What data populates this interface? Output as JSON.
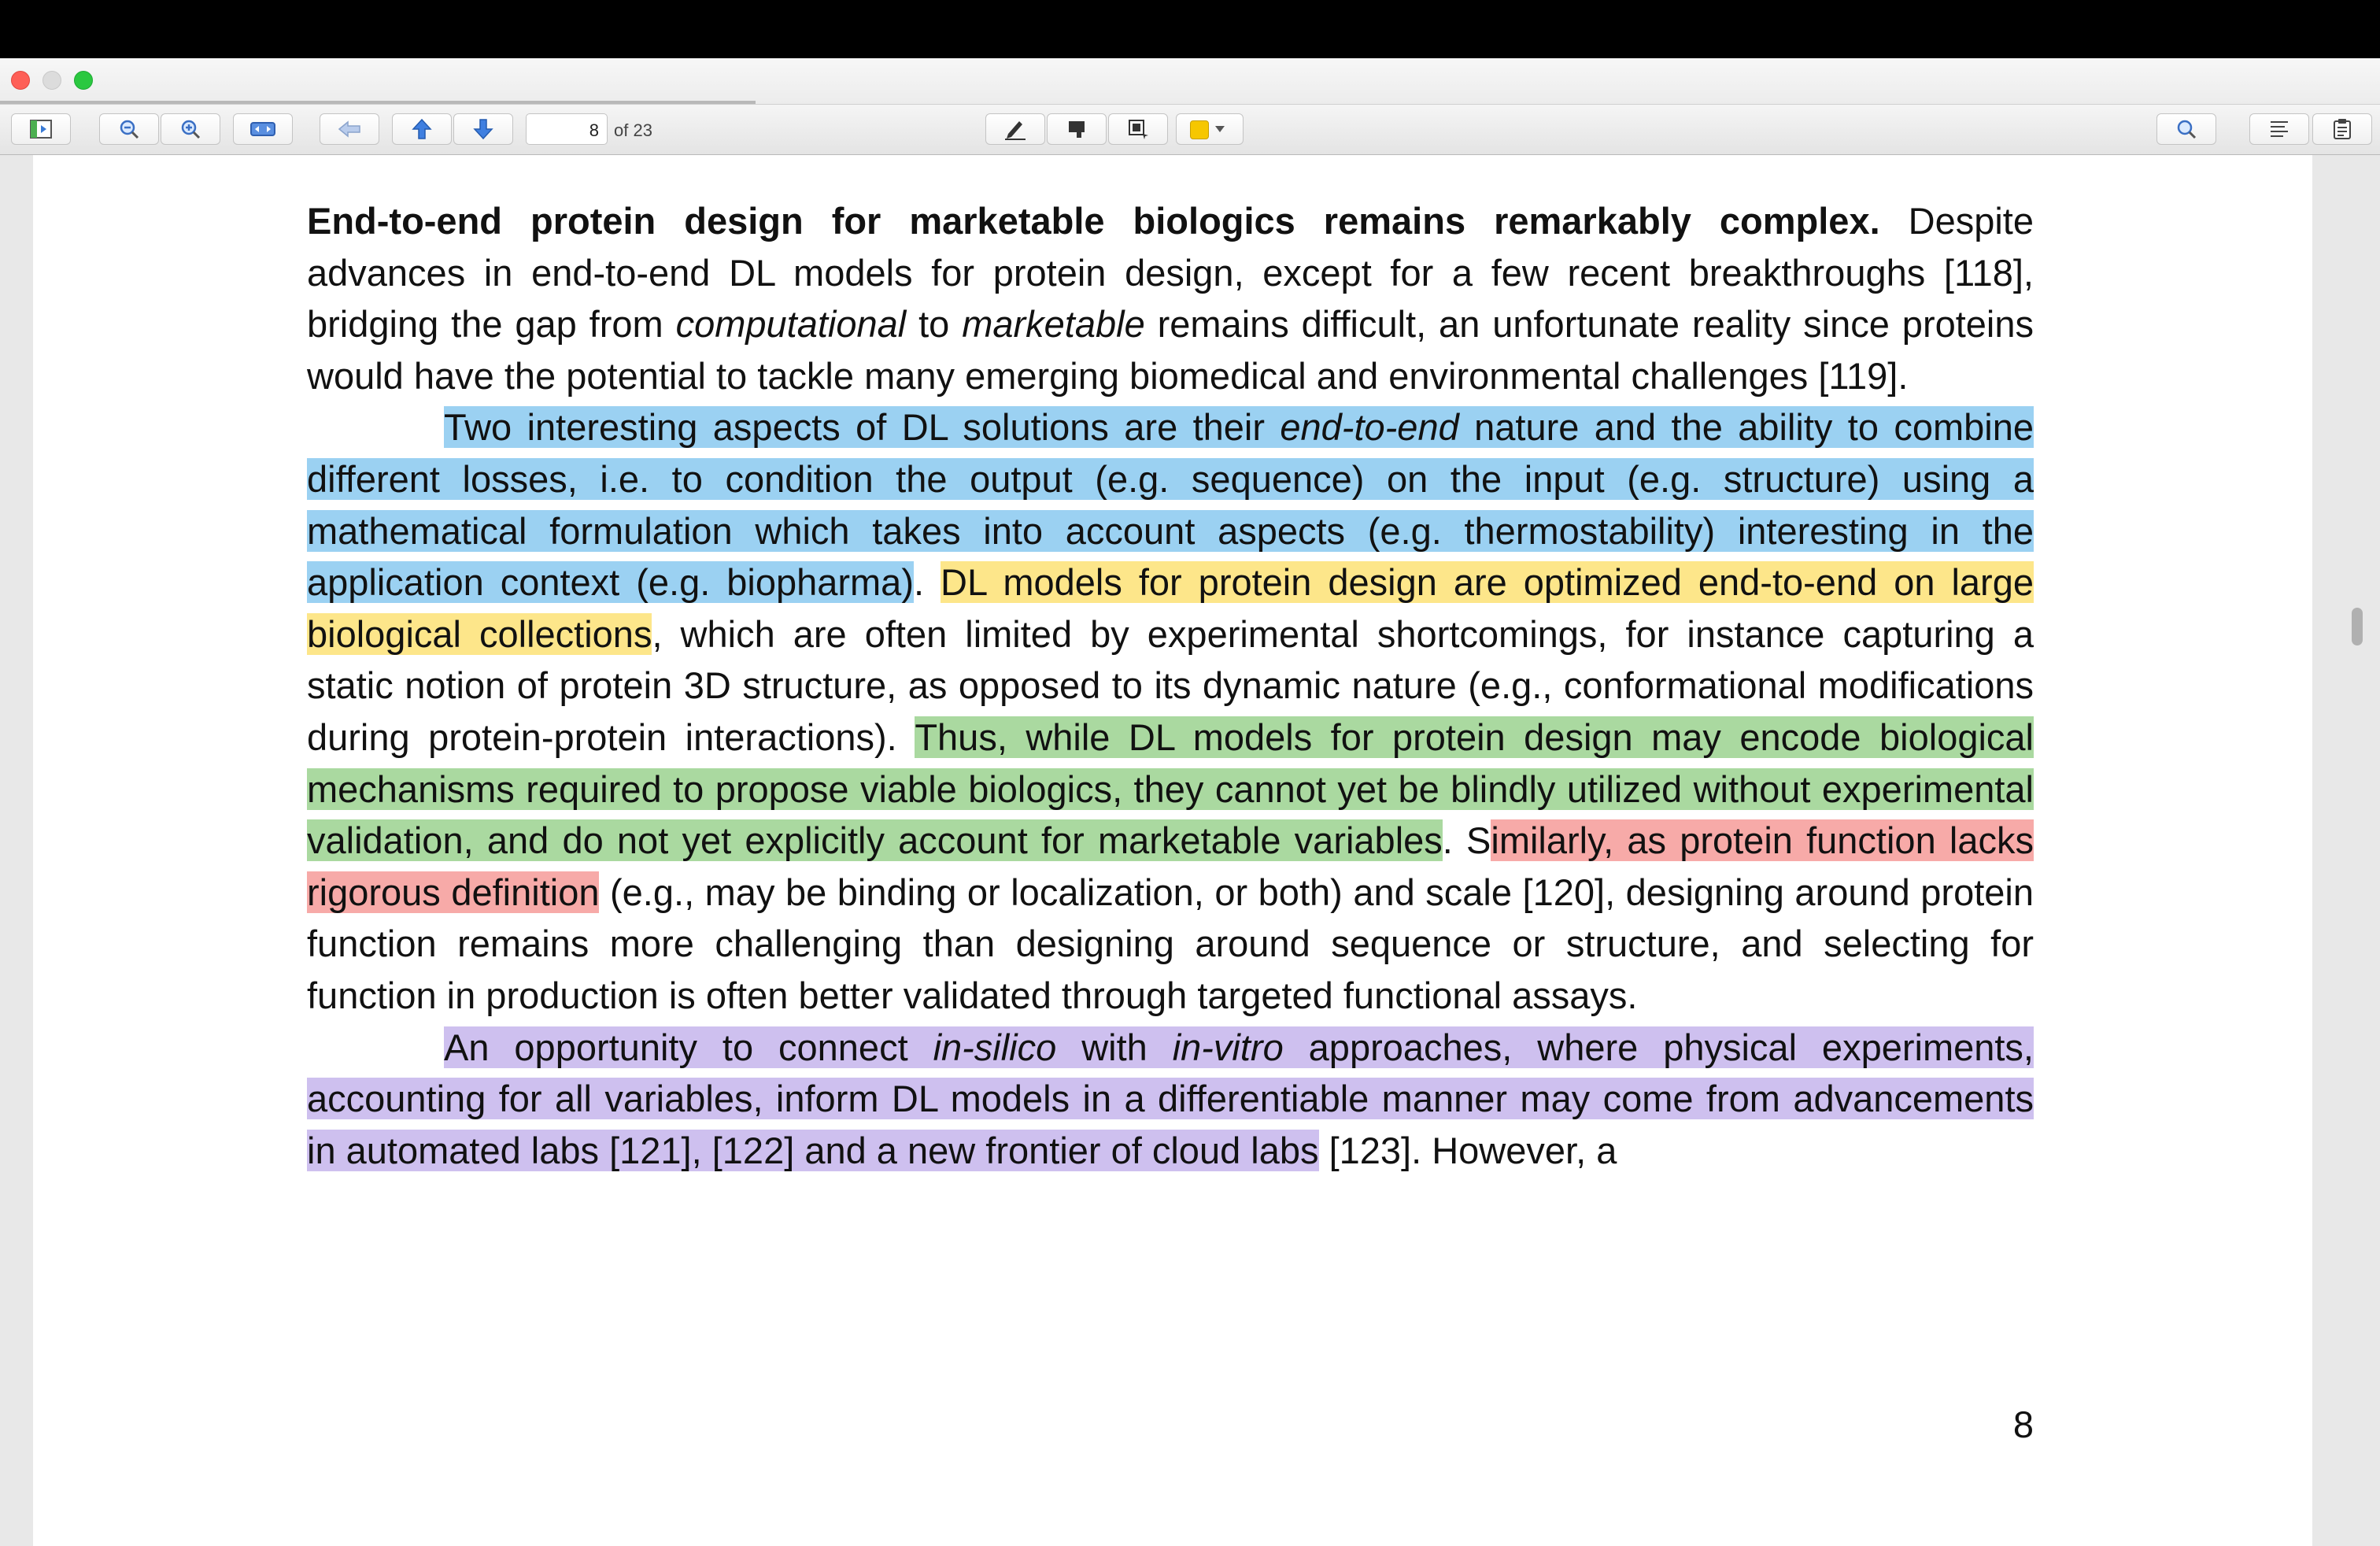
{
  "toolbar": {
    "page_number": "8",
    "page_of": "of 23",
    "highlight_color": "#f6c700",
    "buttons": [
      "sidebar-icon",
      "zoom-out-icon",
      "zoom-in-icon",
      "fit-width-icon",
      "back-icon",
      "previous-page-icon",
      "next-page-icon",
      "pen-icon",
      "stamp-icon",
      "selection-icon",
      "color-swatch-icon",
      "search-icon",
      "text-view-icon",
      "notes-icon"
    ]
  },
  "document": {
    "p1": {
      "bold_heading": "End-to-end protein design for marketable biologics remains remarkably complex.",
      "t1": " Despite advances in end-to-end DL models for protein design, except for a few recent breakthroughs [118], bridging the gap from ",
      "em1": "computational",
      "t2": " to ",
      "em2": "marketable",
      "t3": " remains difficult, an unfortunate reality since proteins would have the potential to tackle many emerging biomedical and environmental challenges [119]."
    },
    "p2": {
      "blue_a": "Two interesting aspects of DL solutions are their ",
      "blue_em": "end-to-end",
      "blue_b": " nature and the ability to combine different losses, i.e. to condition the output (e.g. sequence) on the input (e.g. structure) using a mathematical formulation which takes into account aspects (e.g. thermostability) interesting in the application context (e.g. biopharma)",
      "t1": ". ",
      "yellow": "DL models for protein design are optimized end-to-end on large biological collections",
      "t2": ", which are often limited by experimental shortcomings, for instance capturing a static notion of protein 3D structure, as opposed to its dynamic nature (e.g., conformational modifications during protein-protein interactions). ",
      "green": "Thus, while DL models for protein design may encode biological mechanisms required to propose viable biologics, they cannot yet be blindly utilized without experimental validation, and do not yet explicitly account for marketable variables",
      "t3": ". S",
      "red": "imilarly, as protein function lacks rigorous definition",
      "t4": " (e.g., may be binding or localization, or both) and scale [120], designing around protein function remains more challenging than designing around sequence or structure, and selecting for function in production is often better validated through targeted functional assays."
    },
    "p3": {
      "purple_a": "An opportunity to connect ",
      "purple_em1": "in-silico",
      "purple_b": " with ",
      "purple_em2": "in-vitro",
      "purple_c": " approaches, where physical experiments, accounting for all variables, inform DL models in a differentiable manner may come from advancements in automated labs [121], [122] and a new frontier of cloud labs",
      "t1": " [123]. However, a"
    },
    "page_number": "8"
  }
}
